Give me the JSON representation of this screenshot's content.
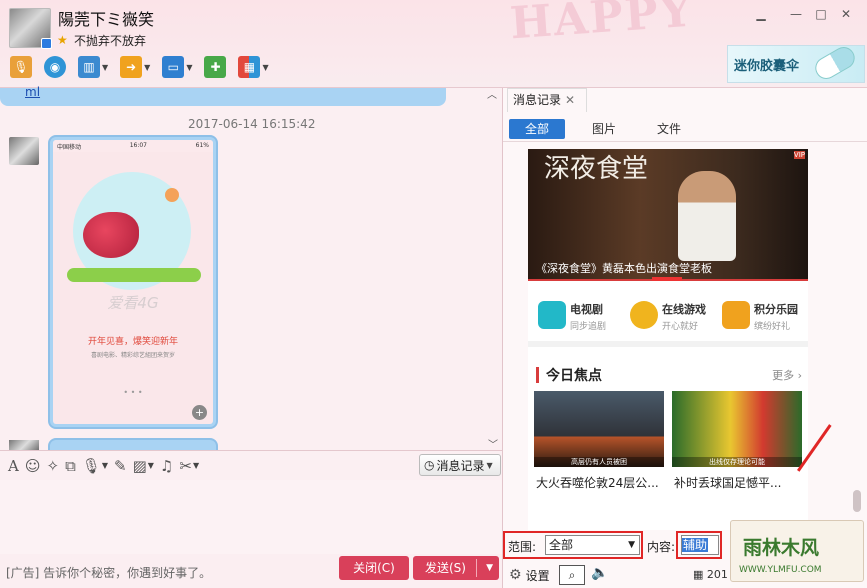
{
  "header": {
    "contact_name": "陽莞下ミ嶶笑",
    "signature": "不抛弃不放弃",
    "background_text": "HAPPY"
  },
  "toolbar": {
    "icons": [
      "microphone-icon",
      "camera-icon",
      "screen-share-icon",
      "file-transfer-icon",
      "remote-desktop-icon",
      "add-app-icon",
      "apps-grid-icon"
    ]
  },
  "ad_banner": {
    "text": "迷你胶囊伞"
  },
  "chat": {
    "prev_link": "ml",
    "timestamp": "2017-06-14 16:15:42",
    "image_message": {
      "carrier": "中国移动",
      "time": "16:07",
      "battery": "61%",
      "tagline": "爱看4G",
      "promo_title": "开年见喜，爆笑迎新年",
      "promo_sub": "喜剧电影、精彩综艺組团来贺岁"
    }
  },
  "input_toolbar": {
    "history_button": "消息记录"
  },
  "footer": {
    "ad_text": "[广告] 告诉你个秘密，你遇到好事了。",
    "close_button": "关闭(C)",
    "send_button": "发送(S)"
  },
  "history_panel": {
    "tab_title": "消息记录",
    "filters": [
      "全部",
      "图片",
      "文件"
    ],
    "banner_caption": "《深夜食堂》黄磊本色出演食堂老板",
    "banner_calligraphy": "深夜食堂",
    "apps": [
      {
        "title": "电视剧",
        "subtitle": "同步追剧",
        "color": "#22b8c8"
      },
      {
        "title": "在线游戏",
        "subtitle": "开心就好",
        "color": "#f0b41e"
      },
      {
        "title": "积分乐园",
        "subtitle": "缤纷好礼",
        "color": "#f0a21e"
      }
    ],
    "focus_title": "今日焦点",
    "focus_more": "更多",
    "news": [
      {
        "caption": "大火吞噬伦敦24层公...",
        "overlay": "高层仍有人员被困"
      },
      {
        "caption": "补时丢球国足憾平...",
        "overlay": "出线仅存理论可能"
      }
    ],
    "range_label": "范围:",
    "range_value": "全部",
    "content_label": "内容:",
    "content_value": "辅助",
    "settings_label": "设置",
    "date_prefix": "201"
  },
  "watermark": {
    "text": "雨林木风",
    "url": "WWW.YLMFU.COM"
  },
  "colors": {
    "accent_blue": "#2b78d0",
    "send_red": "#d9405a",
    "highlight_red": "#e02626"
  }
}
